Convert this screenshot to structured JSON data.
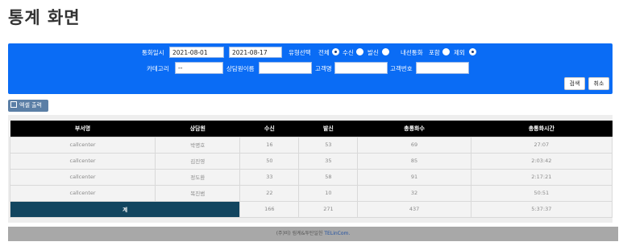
{
  "page_title": "통계 화면",
  "search": {
    "date_label": "통화일시",
    "date_from": "2021-08-01",
    "date_to": "2021-08-17",
    "type_label": "유형선택",
    "type_options": [
      "전체",
      "수신",
      "발신"
    ],
    "type_selected": "전체",
    "internal_label": "내선통화",
    "internal_options": [
      "포함",
      "제외"
    ],
    "internal_selected": "제외",
    "category_label": "카테고리",
    "category_value": "--",
    "agent_label": "상담원이름",
    "agent_value": "",
    "customer_name_label": "고객명",
    "customer_name_value": "",
    "customer_no_label": "고객번호",
    "customer_no_value": "",
    "search_button": "검색",
    "cancel_button": "취소"
  },
  "excel_button": "엑셀 출력",
  "table": {
    "headers": [
      "부서명",
      "상담원",
      "수신",
      "발신",
      "총통화수",
      "총통화시간"
    ],
    "rows": [
      [
        "callcenter",
        "박명호",
        "16",
        "53",
        "69",
        "27:07"
      ],
      [
        "callcenter",
        "김진영",
        "50",
        "35",
        "85",
        "2:03:42"
      ],
      [
        "callcenter",
        "정도환",
        "33",
        "58",
        "91",
        "2:17:21"
      ],
      [
        "callcenter",
        "복진범",
        "22",
        "10",
        "32",
        "50:51"
      ]
    ],
    "total": [
      "계",
      "166",
      "271",
      "437",
      "5:37:37"
    ]
  },
  "footer": {
    "text": "(주)비) 림케&투탄일헌 ",
    "brand": "TELinCom."
  }
}
